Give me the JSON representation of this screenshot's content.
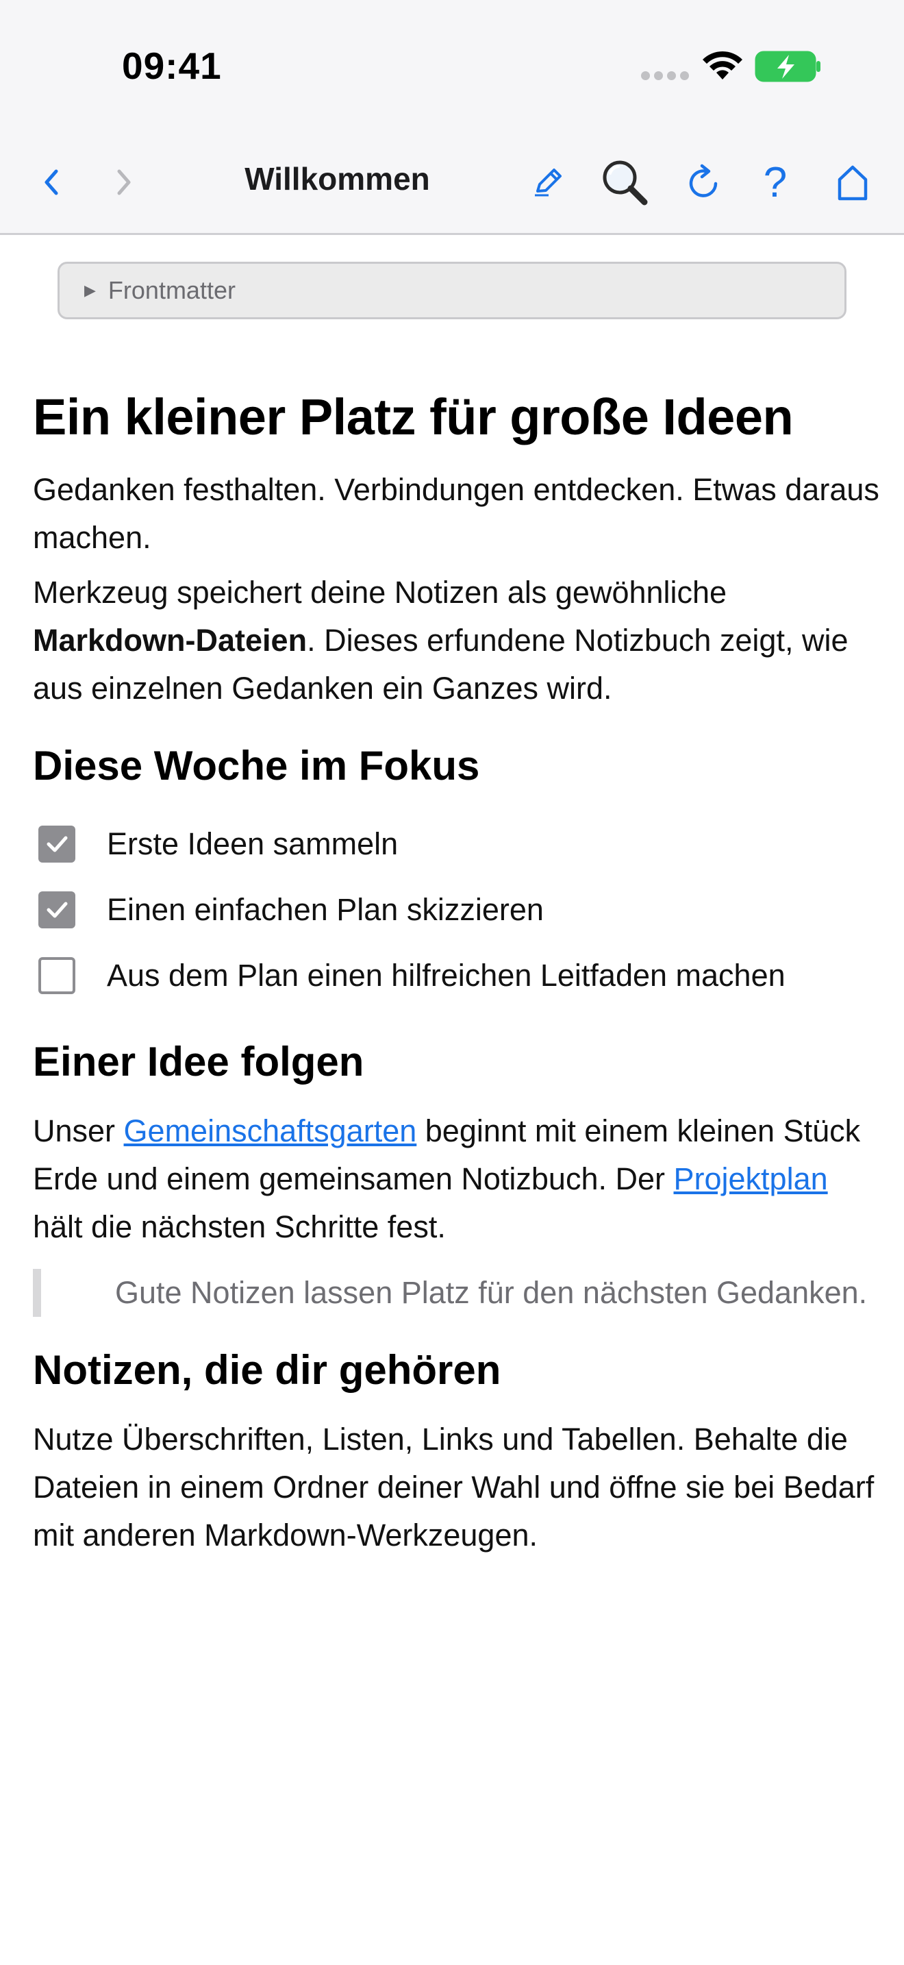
{
  "status_bar": {
    "time": "09:41"
  },
  "toolbar": {
    "title": "Willkommen",
    "help_label": "?"
  },
  "frontmatter": {
    "label": "Frontmatter"
  },
  "colors": {
    "accent": "#1a73e8",
    "battery": "#34c759",
    "checkbox": "#8d8d91"
  },
  "article": {
    "h1": "Ein kleiner Platz für große Ideen",
    "intro": "Gedanken festhalten. Verbindungen entdecken. Etwas daraus machen.",
    "para2_start": "Merkzeug speichert deine Notizen als gewöhnliche ",
    "para2_bold": "Markdown-Dateien",
    "para2_end": ". Dieses erfundene Notizbuch zeigt, wie aus einzelnen Gedanken ein Ganzes wird.",
    "h2_focus": "Diese Woche im Fokus",
    "tasks": [
      {
        "label": "Erste Ideen sammeln",
        "checked": true
      },
      {
        "label": "Einen einfachen Plan skizzieren",
        "checked": true
      },
      {
        "label": "Aus dem Plan einen hilfreichen Leitfaden machen",
        "checked": false
      }
    ],
    "h2_follow": "Einer Idee folgen",
    "follow_1": "Unser ",
    "link_garden": "Gemeinschaftsgarten",
    "follow_2": " beginnt mit einem kleinen Stück Erde und einem gemeinsamen Notizbuch. Der ",
    "link_plan": "Projektplan",
    "follow_3": " hält die nächsten Schritte fest.",
    "quote": "Gute Notizen lassen Platz für den nächsten Gedanken.",
    "h2_own": "Notizen, die dir gehören",
    "own_text": "Nutze Überschriften, Listen, Links und Tabellen. Behalte die Dateien in einem Ordner deiner Wahl und öffne sie bei Bedarf mit anderen Markdown-Werkzeugen."
  }
}
